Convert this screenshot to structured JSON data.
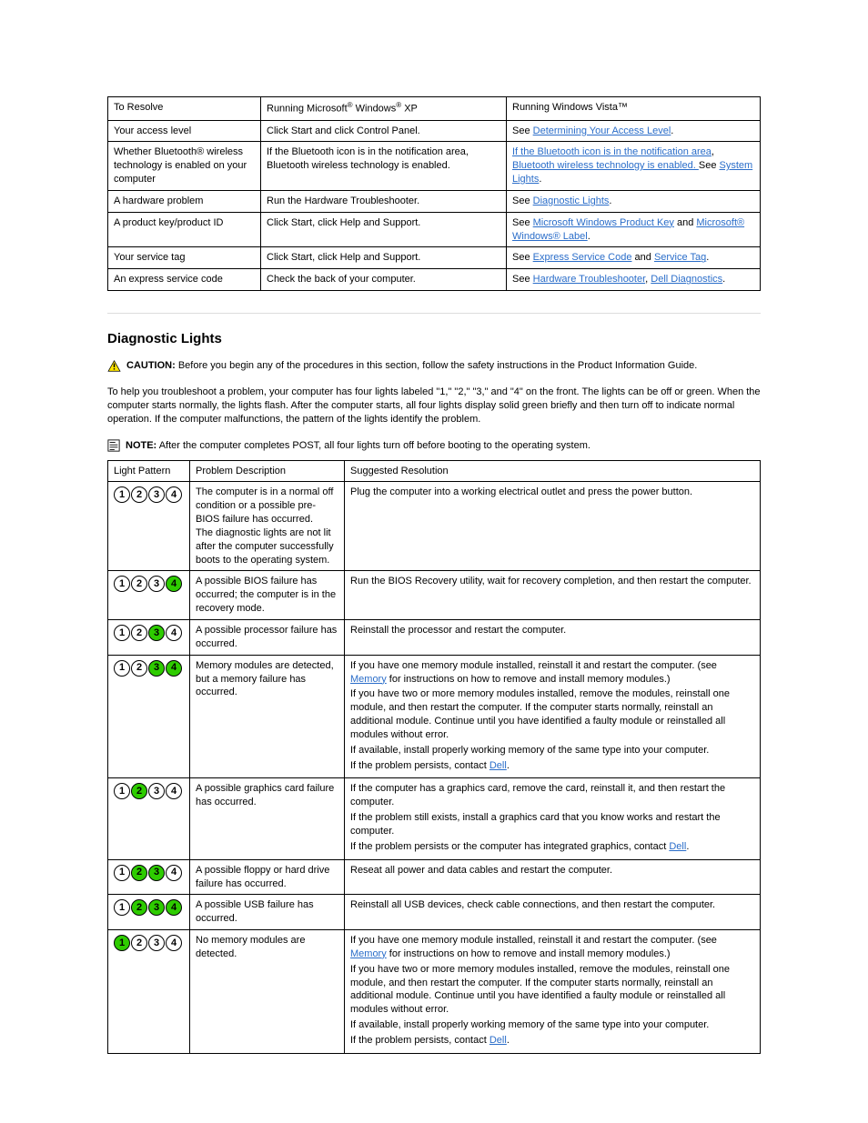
{
  "resourceTable": {
    "headers": [
      "To Resolve",
      "Running Microsoft® Windows® XP",
      "Running Windows Vista™"
    ],
    "rows": [
      {
        "c0": "Your access level",
        "c1": "Click Start and click Control Panel.",
        "c2": "See Determining Your Access Level."
      },
      {
        "c0": "Whether Bluetooth® wireless technology is enabled on your computer",
        "c1": "If the Bluetooth icon is in the notification area, Bluetooth wireless technology is enabled.",
        "c2": "If the Bluetooth icon is in the notification area, Bluetooth wireless technology is enabled. See System Lights."
      },
      {
        "c0": "A hardware problem",
        "c1": "Run the Hardware Troubleshooter.",
        "c2": "See Diagnostic Lights."
      },
      {
        "c0": "A product key/product ID",
        "c1": "Click Start, click Help and Support.",
        "c2": "See Microsoft Windows Product Key and Microsoft® Windows® Label."
      },
      {
        "c0": "Your service tag",
        "c1": "Click Start, click Help and Support.",
        "c2": "See Express Service Code and Service Tag."
      },
      {
        "c0": "An express service code",
        "c1": "Check the back of your computer.",
        "c2": "See Hardware Troubleshooter, Dell Diagnostics."
      }
    ]
  },
  "section": {
    "title": "Diagnostic Lights"
  },
  "caution": {
    "label": "CAUTION:",
    "text": "Before you begin any of the procedures in this section, follow the safety instructions in the Product Information Guide."
  },
  "intro": "To help you troubleshoot a problem, your computer has four lights labeled \"1,\" \"2,\" \"3,\" and \"4\" on the front. The lights can be off or green. When the computer starts normally, the lights flash. After the computer starts, all four lights display solid green briefly and then turn off to indicate normal operation. If the computer malfunctions, the pattern of the lights identify the problem.",
  "note": {
    "label": "NOTE:",
    "text": "After the computer completes POST, all four lights turn off before booting to the operating system."
  },
  "diagTable": {
    "headers": [
      "Light Pattern",
      "Problem Description",
      "Suggested Resolution"
    ],
    "rows": [
      {
        "on": [
          false,
          false,
          false,
          false
        ],
        "desc": "The computer is in a normal off condition or a possible pre-BIOS failure has occurred.\nThe diagnostic lights are not lit after the computer successfully boots to the operating system.",
        "res": [
          {
            "t": "Plug the computer into a working electrical outlet and press the power button."
          }
        ]
      },
      {
        "on": [
          false,
          false,
          false,
          true
        ],
        "desc": "A possible BIOS failure has occurred; the computer is in the recovery mode.",
        "res": [
          {
            "t": "Run the BIOS Recovery utility, wait for recovery completion, and then restart the computer."
          }
        ]
      },
      {
        "on": [
          false,
          false,
          true,
          false
        ],
        "desc": "A possible processor failure has occurred.",
        "res": [
          {
            "t": "Reinstall the processor and restart the computer."
          }
        ]
      },
      {
        "on": [
          false,
          false,
          true,
          true
        ],
        "desc": "Memory modules are detected, but a memory failure has occurred.",
        "res": [
          {
            "t": "If you have one memory module installed, reinstall it and restart the computer. (see ",
            "link": "Memory",
            "after": " for instructions on how to remove and install memory modules.)"
          },
          {
            "t": "If you have two or more memory modules installed, remove the modules, reinstall one module, and then restart the computer. If the computer starts normally, reinstall an additional module. Continue until you have identified a faulty module or reinstalled all modules without error."
          },
          {
            "t": "If available, install properly working memory of the same type into your computer."
          },
          {
            "t": "If the problem persists, contact ",
            "link": "Dell",
            "after": "."
          }
        ]
      },
      {
        "on": [
          false,
          true,
          false,
          false
        ],
        "desc": "A possible graphics card failure has occurred.",
        "res": [
          {
            "t": "If the computer has a graphics card, remove the card, reinstall it, and then restart the computer."
          },
          {
            "t": "If the problem still exists, install a graphics card that you know works and restart the computer."
          },
          {
            "t": "If the problem persists or the computer has integrated graphics, contact ",
            "link": "Dell",
            "after": "."
          }
        ]
      },
      {
        "on": [
          false,
          true,
          true,
          false
        ],
        "desc": "A possible floppy or hard drive failure has occurred.",
        "res": [
          {
            "t": "Reseat all power and data cables and restart the computer."
          }
        ]
      },
      {
        "on": [
          false,
          true,
          true,
          true
        ],
        "desc": "A possible USB failure has occurred.",
        "res": [
          {
            "t": "Reinstall all USB devices, check cable connections, and then restart the computer."
          }
        ]
      },
      {
        "on": [
          true,
          false,
          false,
          false
        ],
        "desc": "No memory modules are detected.",
        "res": [
          {
            "t": "If you have one memory module installed, reinstall it and restart the computer. (see ",
            "link": "Memory",
            "after": " for instructions on how to remove and install memory modules.)"
          },
          {
            "t": "If you have two or more memory modules installed, remove the modules, reinstall one module, and then restart the computer. If the computer starts normally, reinstall an additional module. Continue until you have identified a faulty module or reinstalled all modules without error."
          },
          {
            "t": "If available, install properly working memory of the same type into your computer."
          },
          {
            "t": "If the problem persists, contact ",
            "link": "Dell",
            "after": "."
          }
        ]
      }
    ]
  }
}
